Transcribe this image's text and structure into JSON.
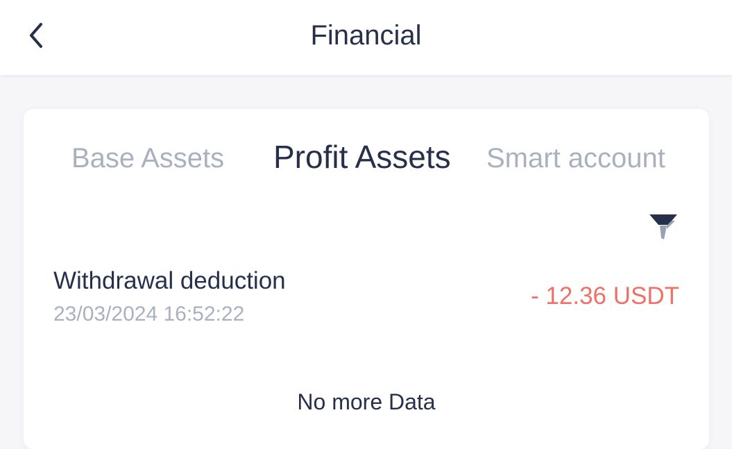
{
  "header": {
    "title": "Financial",
    "back_icon": "chevron-left-icon"
  },
  "tabs": [
    {
      "label": "Base Assets",
      "active": false
    },
    {
      "label": "Profit Assets",
      "active": true
    },
    {
      "label": "Smart account",
      "active": false
    }
  ],
  "filter": {
    "icon": "filter-icon"
  },
  "records": [
    {
      "title": "Withdrawal deduction",
      "time": "23/03/2024 16:52:22",
      "amount": "- 12.36 USDT"
    }
  ],
  "footer": {
    "note": "No more Data"
  },
  "colors": {
    "text_primary": "#27304a",
    "text_muted": "#a9b0bf",
    "negative_amount": "#ef7067",
    "background": "#f6f6f9",
    "card": "#ffffff"
  }
}
